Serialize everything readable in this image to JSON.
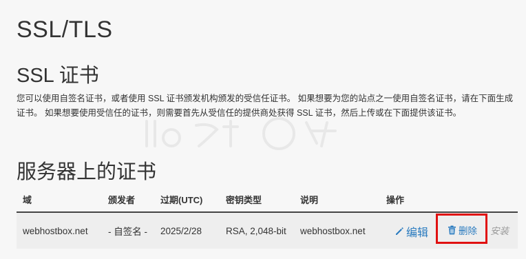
{
  "page": {
    "title": "SSL/TLS"
  },
  "ssl_section": {
    "title": "SSL 证书",
    "description": "您可以使用自签名证书，或者使用 SSL 证书颁发机构颁发的受信任证书。 如果想要为您的站点之一使用自签名证书，请在下面生成证书。 如果想要使用受信任的证书，则需要首先从受信任的提供商处获得 SSL 证书，然后上传或在下面提供该证书。"
  },
  "server_certs": {
    "title": "服务器上的证书",
    "columns": [
      "域",
      "颁发者",
      "过期(UTC)",
      "密钥类型",
      "说明",
      "操作"
    ],
    "rows": [
      {
        "domain": "webhostbox.net",
        "issuer": "- 自签名 -",
        "expires": "2025/2/28",
        "key_type": "RSA, 2,048-bit",
        "description": "webhostbox.net",
        "actions": {
          "edit": "编辑",
          "delete": "删除",
          "install": "安装"
        }
      }
    ]
  },
  "colors": {
    "link": "#2a7bbf",
    "highlight": "#e01010",
    "disabled": "#999999"
  },
  "icons": {
    "edit": "pencil-icon",
    "delete": "trash-icon"
  }
}
